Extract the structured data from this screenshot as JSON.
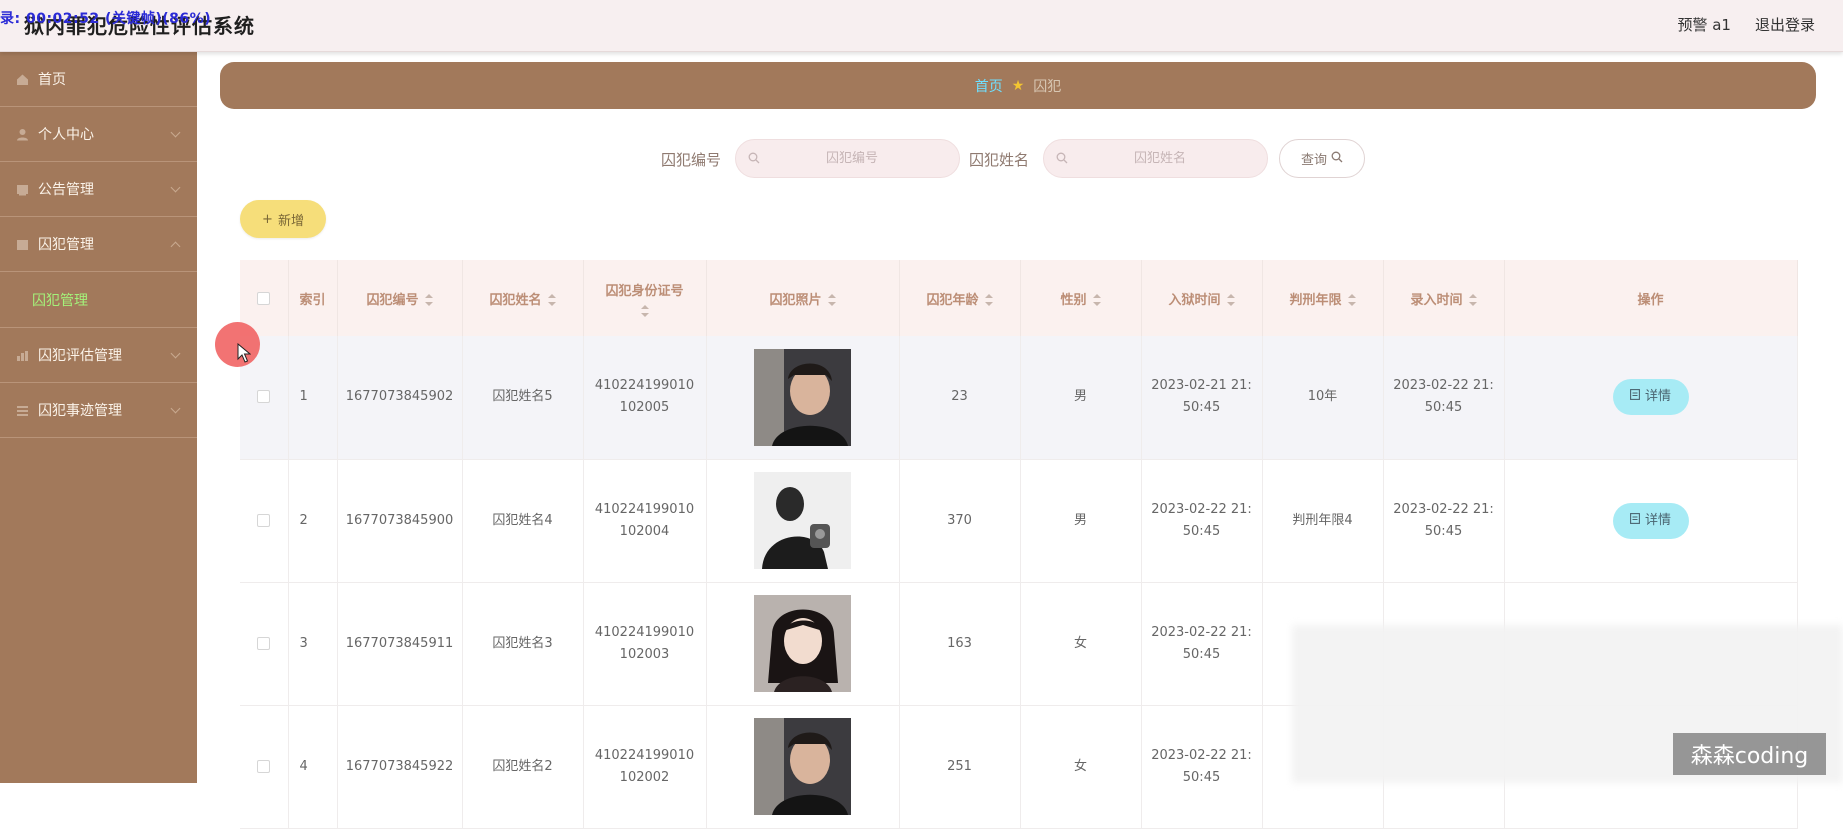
{
  "header": {
    "title": "狱内罪犯危险性评估系统",
    "recording_overlay": "录: 00:02:52 (关键帧)(86%)",
    "user_label": "预警 a1",
    "logout_label": "退出登录"
  },
  "sidebar": {
    "items": [
      {
        "label": "首页",
        "icon": "home-icon"
      },
      {
        "label": "个人中心",
        "icon": "user-icon"
      },
      {
        "label": "公告管理",
        "icon": "notice-icon"
      },
      {
        "label": "囚犯管理",
        "icon": "folder-icon"
      },
      {
        "label": "囚犯管理",
        "icon": ""
      },
      {
        "label": "囚犯评估管理",
        "icon": "chart-icon"
      },
      {
        "label": "囚犯事迹管理",
        "icon": "list-icon"
      }
    ]
  },
  "breadcrumb": {
    "home": "首页",
    "current": "囚犯"
  },
  "search": {
    "id_label": "囚犯编号",
    "id_placeholder": "囚犯编号",
    "name_label": "囚犯姓名",
    "name_placeholder": "囚犯姓名",
    "query_label": "查询"
  },
  "toolbar": {
    "add_label": "新增"
  },
  "table": {
    "columns": [
      "索引",
      "囚犯编号",
      "囚犯姓名",
      "囚犯身份证号",
      "囚犯照片",
      "囚犯年龄",
      "性别",
      "入狱时间",
      "判刑年限",
      "录入时间",
      "操作"
    ],
    "detail_label": "详情",
    "rows": [
      {
        "index": "1",
        "code": "1677073845902",
        "name": "囚犯姓名5",
        "id_line1": "410224199010",
        "id_line2": "102005",
        "age": "23",
        "gender": "男",
        "jail_line1": "2023-02-21 21:",
        "jail_line2": "50:45",
        "sentence": "10年",
        "entry_line1": "2023-02-22 21:",
        "entry_line2": "50:45"
      },
      {
        "index": "2",
        "code": "1677073845900",
        "name": "囚犯姓名4",
        "id_line1": "410224199010",
        "id_line2": "102004",
        "age": "370",
        "gender": "男",
        "jail_line1": "2023-02-22 21:",
        "jail_line2": "50:45",
        "sentence": "判刑年限4",
        "entry_line1": "2023-02-22 21:",
        "entry_line2": "50:45"
      },
      {
        "index": "3",
        "code": "1677073845911",
        "name": "囚犯姓名3",
        "id_line1": "410224199010",
        "id_line2": "102003",
        "age": "163",
        "gender": "女",
        "jail_line1": "2023-02-22 21:",
        "jail_line2": "50:45",
        "sentence": "",
        "entry_line1": "",
        "entry_line2": ""
      },
      {
        "index": "4",
        "code": "1677073845922",
        "name": "囚犯姓名2",
        "id_line1": "410224199010",
        "id_line2": "102002",
        "age": "251",
        "gender": "女",
        "jail_line1": "2023-02-22 21:",
        "jail_line2": "50:45",
        "sentence": "",
        "entry_line1": "",
        "entry_line2": ""
      }
    ]
  },
  "watermark": "森森coding",
  "colors": {
    "sidebar": "#a2795b",
    "header": "#f7eff0",
    "add_button": "#f6de7a",
    "detail_button": "#a7ebf5",
    "submenu_active": "#a4f27a"
  }
}
